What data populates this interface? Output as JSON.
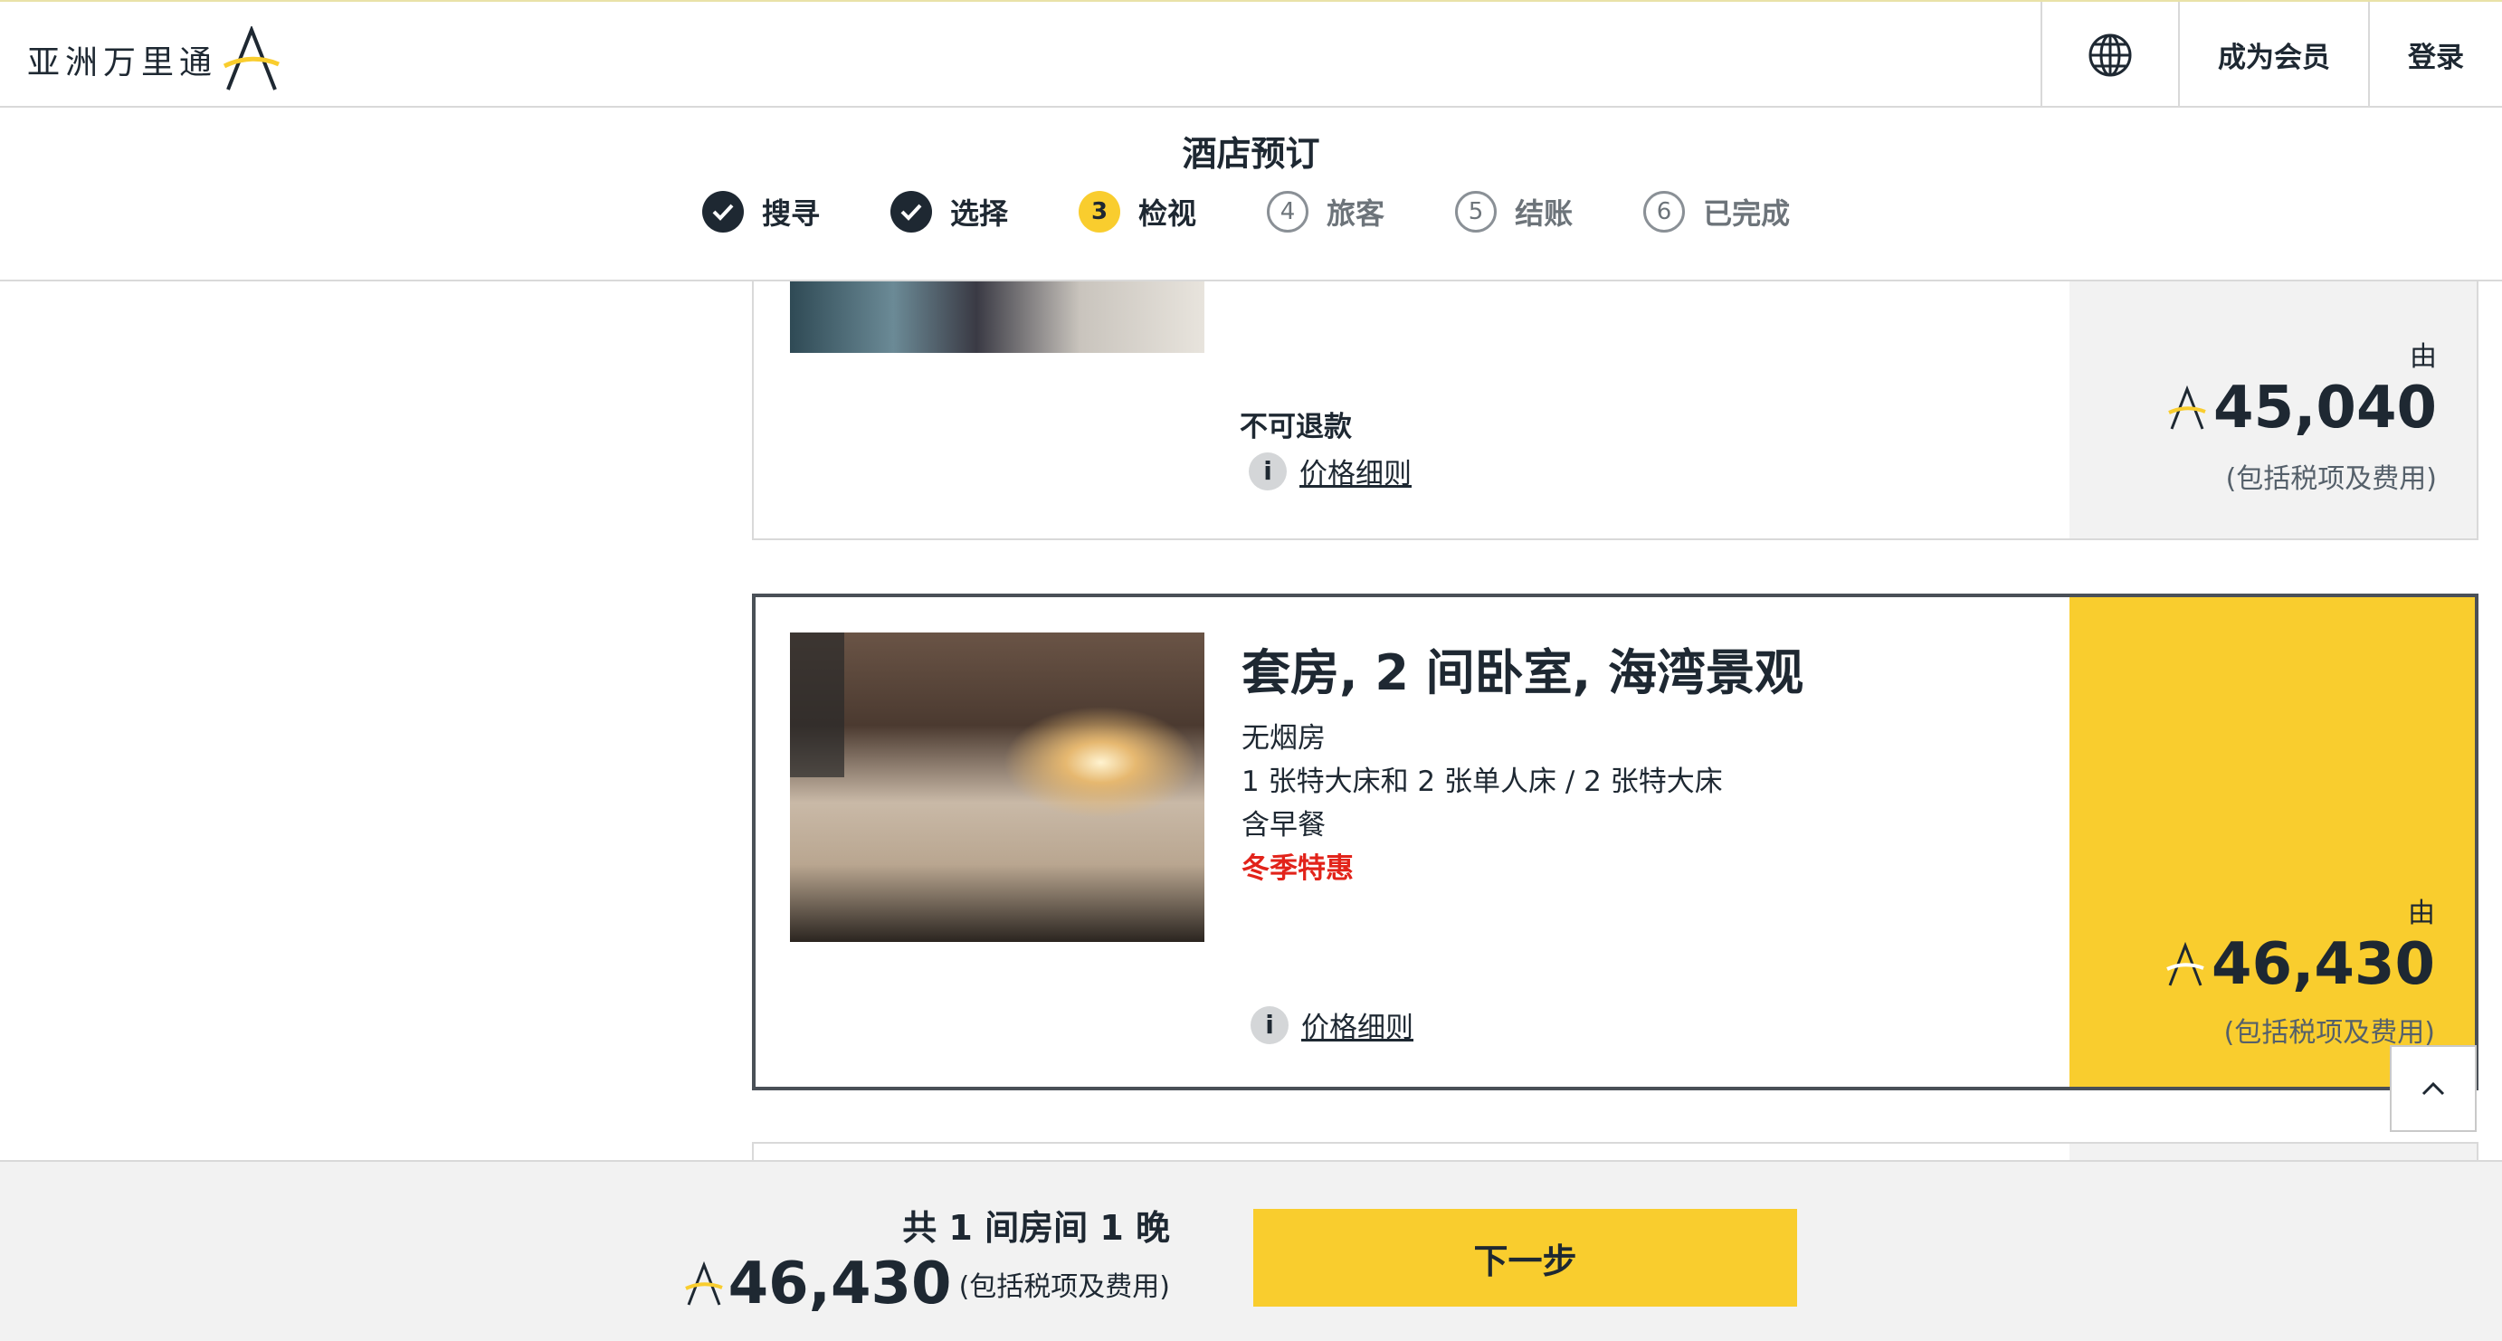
{
  "header": {
    "logo_text": "亚洲万里通",
    "logo_icon": "asia-miles-a-icon",
    "language_icon": "globe-icon",
    "join_label": "成为会员",
    "login_label": "登录"
  },
  "booking": {
    "title": "酒店预订",
    "steps": [
      {
        "number": "1",
        "label": "搜寻",
        "state": "done"
      },
      {
        "number": "2",
        "label": "选择",
        "state": "done"
      },
      {
        "number": "3",
        "label": "检视",
        "state": "active"
      },
      {
        "number": "4",
        "label": "旅客",
        "state": "todo"
      },
      {
        "number": "5",
        "label": "结账",
        "state": "todo"
      },
      {
        "number": "6",
        "label": "已完成",
        "state": "todo"
      }
    ]
  },
  "rooms": [
    {
      "refund_policy": "不可退款",
      "price_details_label": "价格细则",
      "from_label": "由",
      "price": "45,040",
      "tax_note": "(包括税项及费用)"
    },
    {
      "title": "套房, 2 间卧室, 海湾景观",
      "smoking": "无烟房",
      "beds": "1 张特大床和 2 张单人床 / 2 张特大床",
      "meal": "含早餐",
      "promo": "冬季特惠",
      "price_details_label": "价格细则",
      "from_label": "由",
      "price": "46,430",
      "tax_note": "(包括税项及费用)",
      "selected": true
    }
  ],
  "summary": {
    "rooms_nights": "共 1 间房间 1 晚",
    "price": "46,430",
    "tax_note": "(包括税项及费用)",
    "next_label": "下一步"
  },
  "colors": {
    "accent": "#f9cd2e",
    "dark": "#1e2832",
    "promo": "#e2231a"
  }
}
